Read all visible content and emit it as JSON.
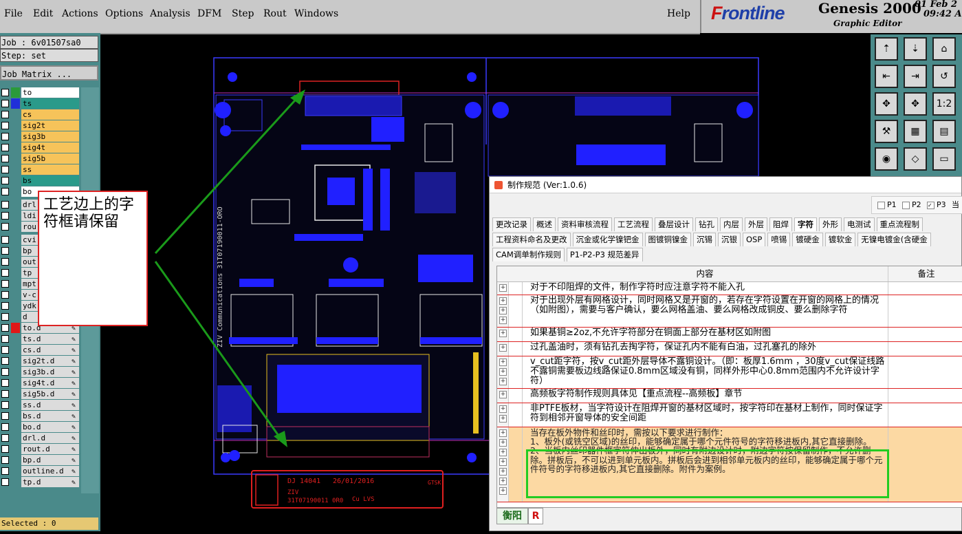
{
  "menu": {
    "items": [
      "File",
      "Edit",
      "Actions",
      "Options",
      "Analysis",
      "DFM",
      "Step",
      "Rout",
      "Windows"
    ],
    "help": "Help"
  },
  "brand": {
    "logo": "Frontline",
    "product": "Genesis 2000",
    "subtitle": "Graphic Editor",
    "date": "01 Feb 2",
    "time": "09:42 A"
  },
  "job": {
    "job_label": "Job : 6v01507sa0",
    "step_label": "Step: set",
    "matrix_button": "Job Matrix ..."
  },
  "layers": [
    {
      "name": "to",
      "color": "#ffffff",
      "swatch": "#2a9a3a"
    },
    {
      "name": "ts",
      "color": "#2a9a8a",
      "swatch": "#2030d8"
    },
    {
      "name": "cs",
      "color": "#f6c35a",
      "swatch": ""
    },
    {
      "name": "sig2t",
      "color": "#f6c35a",
      "swatch": ""
    },
    {
      "name": "sig3b",
      "color": "#f6c35a",
      "swatch": ""
    },
    {
      "name": "sig4t",
      "color": "#f6c35a",
      "swatch": ""
    },
    {
      "name": "sig5b",
      "color": "#f6c35a",
      "swatch": ""
    },
    {
      "name": "ss",
      "color": "#f6c35a",
      "swatch": ""
    },
    {
      "name": "bs",
      "color": "#2a9a8a",
      "swatch": ""
    },
    {
      "name": "bo",
      "color": "#ffffff",
      "swatch": ""
    },
    {
      "name": "drl",
      "color": "#dcdcdc",
      "swatch": ""
    },
    {
      "name": "ldi",
      "color": "#dcdcdc",
      "swatch": ""
    },
    {
      "name": "rou",
      "color": "#dcdcdc",
      "swatch": ""
    },
    {
      "name": "cvi",
      "color": "#dcdcdc",
      "swatch": ""
    },
    {
      "name": "bp",
      "color": "#dcdcdc",
      "swatch": ""
    },
    {
      "name": "out",
      "color": "#dcdcdc",
      "swatch": ""
    },
    {
      "name": "tp",
      "color": "#dcdcdc",
      "swatch": ""
    },
    {
      "name": "mpt",
      "color": "#dcdcdc",
      "swatch": ""
    },
    {
      "name": "v-c",
      "color": "#dcdcdc",
      "swatch": ""
    },
    {
      "name": "ydk",
      "color": "#dcdcdc",
      "swatch": ""
    },
    {
      "name": "d",
      "color": "#dcdcdc",
      "swatch": ""
    },
    {
      "name": "to.d",
      "color": "#dcdcdc",
      "swatch": "#e01818"
    },
    {
      "name": "ts.d",
      "color": "#dcdcdc",
      "swatch": ""
    },
    {
      "name": "cs.d",
      "color": "#dcdcdc",
      "swatch": ""
    },
    {
      "name": "sig2t.d",
      "color": "#dcdcdc",
      "swatch": ""
    },
    {
      "name": "sig3b.d",
      "color": "#dcdcdc",
      "swatch": ""
    },
    {
      "name": "sig4t.d",
      "color": "#dcdcdc",
      "swatch": ""
    },
    {
      "name": "sig5b.d",
      "color": "#dcdcdc",
      "swatch": ""
    },
    {
      "name": "ss.d",
      "color": "#dcdcdc",
      "swatch": ""
    },
    {
      "name": "bs.d",
      "color": "#dcdcdc",
      "swatch": ""
    },
    {
      "name": "bo.d",
      "color": "#dcdcdc",
      "swatch": ""
    },
    {
      "name": "drl.d",
      "color": "#dcdcdc",
      "swatch": ""
    },
    {
      "name": "rout.d",
      "color": "#dcdcdc",
      "swatch": ""
    },
    {
      "name": "bp.d",
      "color": "#dcdcdc",
      "swatch": ""
    },
    {
      "name": "outline.d",
      "color": "#dcdcdc",
      "swatch": ""
    },
    {
      "name": "tp.d",
      "color": "#dcdcdc",
      "swatch": ""
    }
  ],
  "selected_label": "Selected : 0",
  "annotation": "工艺边上的字符框请保留",
  "pcb": {
    "vertical_text": "ZIV Communications 31T07190011-ORO",
    "stamp_text1": "DJ 14041",
    "stamp_text2": "26/01/2016",
    "stamp_text3": "ZIV",
    "stamp_text4": "31T07190011 0R0",
    "stamp_text5": "Cu LVS",
    "side_label": "GTSK"
  },
  "toolbar": {
    "buttons": [
      "⇡",
      "⇣",
      "⌂",
      "⇤",
      "⇥",
      "↺",
      "✥",
      "✥",
      "1:2",
      "⚒",
      "▦",
      "▤",
      "◉",
      "◇",
      "▭"
    ]
  },
  "dialog": {
    "title": "制作规范 (Ver:1.0.6)",
    "p_boxes": [
      "P1",
      "P2",
      "P3",
      "当"
    ],
    "tabs_row1": [
      "更改记录",
      "概述",
      "资料审核流程",
      "工艺流程",
      "叠层设计",
      "钻孔",
      "内层",
      "外层",
      "阻焊",
      "字符",
      "外形",
      "电测试",
      "重点流程制"
    ],
    "active_tab": "字符",
    "tabs_row2": [
      "工程资料命名及更改",
      "沉金或化学镍钯金",
      "图镀铜镍金",
      "沉锡",
      "沉银",
      "OSP",
      "喷锡",
      "镀硬金",
      "镀软金",
      "无镍电镀金(含硬金"
    ],
    "tabs_row3": [
      "CAM调单制作规则",
      "P1-P2-P3 规范差异"
    ],
    "grid_header_content": "内容",
    "grid_header_note": "备注",
    "rows": [
      "对于不印阻焊的文件，制作字符时应注意字符不能入孔",
      "对于出现外层有网格设计，同时网格又是开窗的，若存在字符设置在开窗的网格上的情况（如附图），需要与客户确认，要么网格盖油、要么网格改成铜皮、要么删除字符",
      "如果基铜≥2oz,不允许字符部分在铜面上部分在基材区如附图",
      "过孔盖油时，须有钻孔去掏字符，保证孔内不能有白油，过孔塞孔的除外",
      "  v_cut距字符，按v_cut距外层导体不露铜设计。（即：板厚1.6mm ，30度v_cut保证线路不露铜需要板边线路保证0.8mm区域没有铜，同样外形中心0.8mm范围内不允许设计字符）",
      "高频板字符制作规则具体见【重点流程--高频板】章节",
      "非PTFE板材，当字符设计在阻焊开窗的基材区域时，按字符印在基材上制作，同时保证字符到相邻开窗导体的安全间距",
      "当存在板外物件和丝印时，需按以下要求进行制作：\n1、板外(或铣空区域)的丝印，能够确定属于哪个元件符号的字符移进板内,其它直接删除。\n2、当板内丝印器件框字符伸出板外，同时有附边设计时，附边字符按保留制作，不允许删除。拼板后，不可以进到单元板内。拼板后会进到相邻单元板内的丝印，能够确定属于哪个元件符号的字符移进板内,其它直接删除。附件为案例。"
    ],
    "bottom_tabs": [
      "衡阳",
      "R"
    ]
  }
}
